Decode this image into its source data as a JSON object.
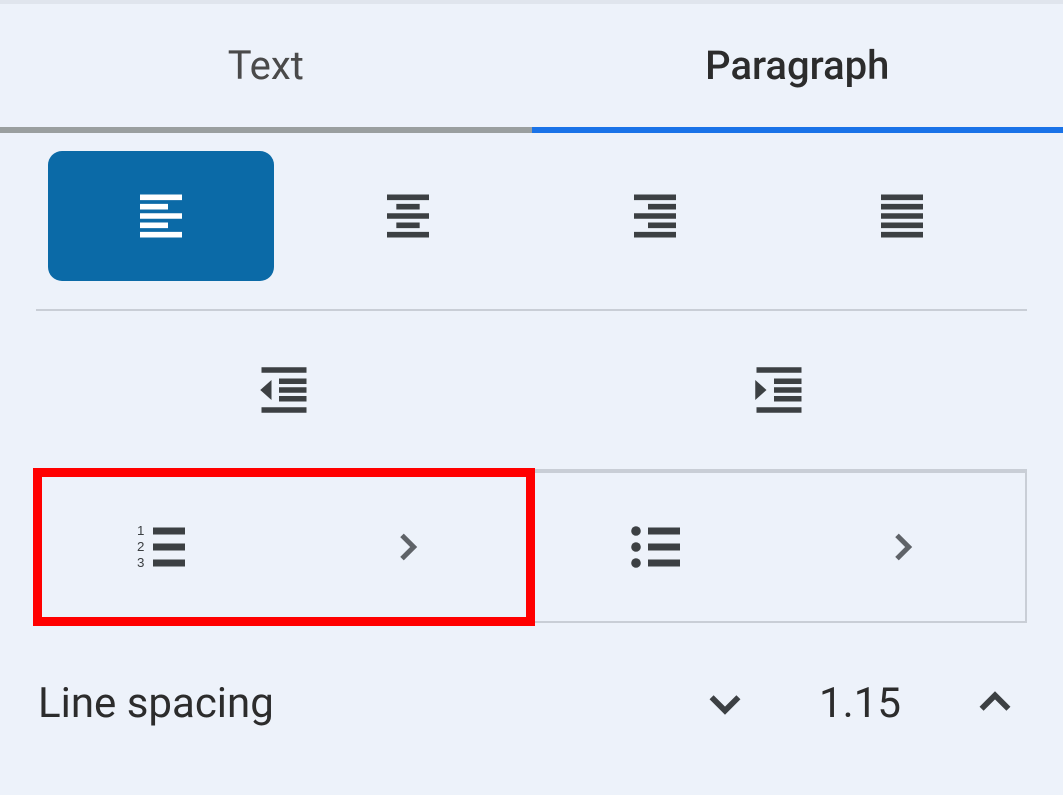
{
  "tabs": {
    "text": "Text",
    "paragraph": "Paragraph",
    "active_index": 1
  },
  "alignment": {
    "active_index": 0
  },
  "line_spacing": {
    "label": "Line spacing",
    "value": "1.15"
  },
  "highlight": {
    "list_numbered": true
  }
}
